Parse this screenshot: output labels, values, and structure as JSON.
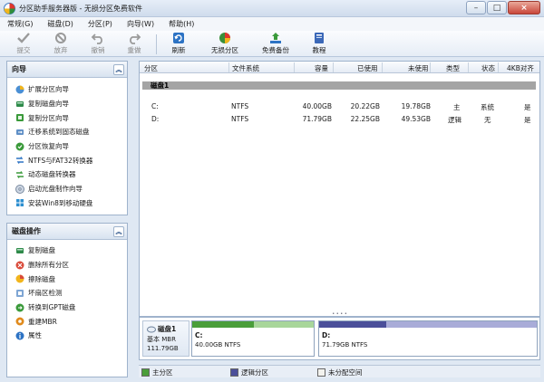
{
  "window": {
    "title": "分区助手服务器版 - 无损分区免费软件"
  },
  "menu": [
    {
      "label": "常规(G)"
    },
    {
      "label": "磁盘(D)"
    },
    {
      "label": "分区(P)"
    },
    {
      "label": "向导(W)"
    },
    {
      "label": "帮助(H)"
    }
  ],
  "toolbar": {
    "commit": "提交",
    "discard": "放弃",
    "undo": "撤销",
    "redo": "重做",
    "refresh": "刷新",
    "lossless": "无损分区",
    "backup": "免费备份",
    "tutorial": "教程"
  },
  "wizard_panel": {
    "title": "向导",
    "items": [
      {
        "label": "扩展分区向导",
        "icon": "extend-partition-icon"
      },
      {
        "label": "复制磁盘向导",
        "icon": "copy-disk-icon"
      },
      {
        "label": "复制分区向导",
        "icon": "copy-partition-icon"
      },
      {
        "label": "迁移系统到固态磁盘",
        "icon": "migrate-os-icon"
      },
      {
        "label": "分区恢复向导",
        "icon": "partition-recovery-icon"
      },
      {
        "label": "NTFS与FAT32转换器",
        "icon": "ntfs-fat32-icon"
      },
      {
        "label": "动态磁盘转换器",
        "icon": "dynamic-disk-icon"
      },
      {
        "label": "启动光盘制作向导",
        "icon": "bootable-cd-icon"
      },
      {
        "label": "安装Win8到移动硬盘",
        "icon": "win8-to-go-icon"
      }
    ]
  },
  "disk_ops_panel": {
    "title": "磁盘操作",
    "items": [
      {
        "label": "复制磁盘",
        "icon": "copy-disk-icon"
      },
      {
        "label": "删除所有分区",
        "icon": "delete-all-icon"
      },
      {
        "label": "擦除磁盘",
        "icon": "wipe-disk-icon"
      },
      {
        "label": "坏扇区检测",
        "icon": "bad-sector-icon"
      },
      {
        "label": "转换到GPT磁盘",
        "icon": "convert-gpt-icon"
      },
      {
        "label": "重建MBR",
        "icon": "rebuild-mbr-icon"
      },
      {
        "label": "属性",
        "icon": "properties-icon"
      }
    ]
  },
  "table": {
    "columns": [
      "分区",
      "文件系统",
      "容量",
      "已使用",
      "未使用",
      "类型",
      "状态",
      "4KB对齐"
    ],
    "group_label": "磁盘1",
    "rows": [
      {
        "partition": "C:",
        "fs": "NTFS",
        "capacity": "40.00GB",
        "used": "20.22GB",
        "free": "19.78GB",
        "type": "主",
        "status": "系统",
        "aligned": "是"
      },
      {
        "partition": "D:",
        "fs": "NTFS",
        "capacity": "71.79GB",
        "used": "22.25GB",
        "free": "49.53GB",
        "type": "逻辑",
        "status": "无",
        "aligned": "是"
      }
    ]
  },
  "disk_map": {
    "disk_name": "磁盘1",
    "disk_type": "基本 MBR",
    "disk_size": "111.79GB",
    "partitions": [
      {
        "letter": "C:",
        "desc": "40.00GB NTFS",
        "used_fraction": 0.51,
        "color": "#4a9e3a"
      },
      {
        "letter": "D:",
        "desc": "71.79GB NTFS",
        "used_fraction": 0.31,
        "color": "#4b4f9a"
      }
    ]
  },
  "legend": {
    "primary": "主分区",
    "logical": "逻辑分区",
    "unallocated": "未分配空间",
    "primary_color": "#4a9e3a",
    "logical_color": "#4b4f9a",
    "unallocated_color": "#f2f2ee"
  }
}
